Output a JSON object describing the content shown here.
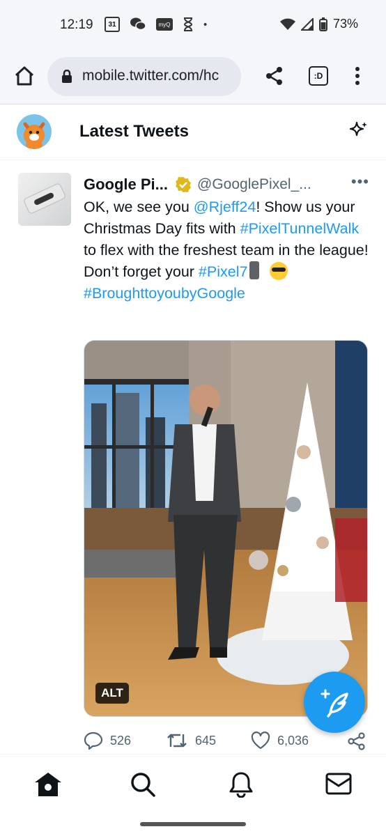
{
  "status_bar": {
    "time": "12:19",
    "calendar_day": "31",
    "myq_label": "myQ",
    "dot": "•",
    "battery": "73%"
  },
  "browser": {
    "url": "mobile.twitter.com/hc",
    "tabs_label": ":D"
  },
  "header": {
    "title": "Latest Tweets"
  },
  "tweet": {
    "author_name": "Google Pi...",
    "handle": "@GooglePixel_...",
    "more": "•••",
    "text": {
      "part1": "OK, we see you ",
      "mention": "@Rjeff24",
      "part2": "! Show us your Christmas Day fits with ",
      "hashtag1": "#PixelTunnelWalk",
      "part3": " to flex with the freshest team in the league! Don’t forget your ",
      "hashtag2": "#Pixel7",
      "hashtag3": "#BroughttoyoubyGoogle"
    },
    "alt_badge": "ALT",
    "replies": "526",
    "retweets": "645",
    "likes": "6,036"
  },
  "colors": {
    "accent": "#1d9bf0",
    "text": "#0f1419",
    "muted": "#536471"
  }
}
